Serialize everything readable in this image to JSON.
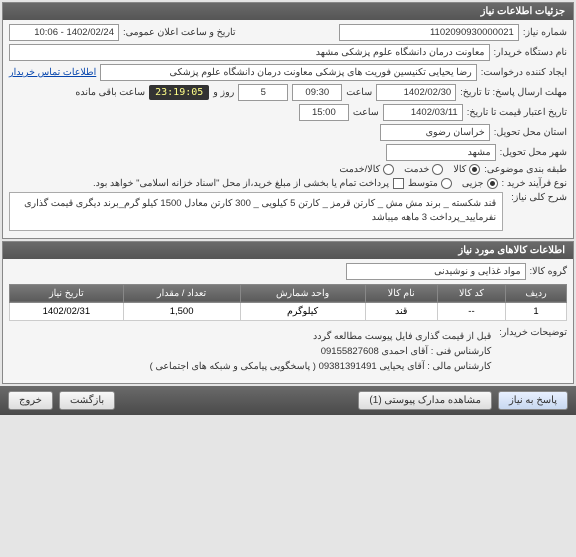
{
  "panel1": {
    "title": "جزئیات اطلاعات نیاز",
    "reqNoLabel": "شماره نیاز:",
    "reqNo": "1102090930000021",
    "announceLabel": "تاریخ و ساعت اعلان عمومی:",
    "announceVal": "1402/02/24 - 10:06",
    "buyerLabel": "نام دستگاه خریدار:",
    "buyerVal": "معاونت درمان دانشگاه علوم پزشکی مشهد",
    "creatorLabel": "ایجاد کننده درخواست:",
    "creatorVal": "رضا یحیایی تکنیسین فوریت های پزشکی معاونت درمان دانشگاه علوم پزشکی",
    "contactLink": "اطلاعات تماس خریدار",
    "deadlineLabel": "مهلت ارسال پاسخ: تا تاریخ:",
    "deadlineDate": "1402/02/30",
    "timeLabel": "ساعت",
    "deadlineTime": "09:30",
    "dayLabel": "روز و",
    "daysLeft": "5",
    "countdown": "23:19:05",
    "remaining": "ساعت باقی مانده",
    "validLabel": "تاریخ اعتبار قیمت تا تاریخ:",
    "validDate": "1402/03/11",
    "validTime": "15:00",
    "provinceLabel": "استان محل تحویل:",
    "province": "خراسان رضوی",
    "cityLabel": "شهر محل تحویل:",
    "city": "مشهد",
    "classLabel": "طبقه بندی موضوعی:",
    "class1": "کالا",
    "class2": "خدمت",
    "class3": "کالا/خدمت",
    "procLabel": "نوع فرآیند خرید :",
    "proc1": "جزیی",
    "proc2": "متوسط",
    "procNote": "پرداخت تمام یا بخشی از مبلغ خرید،از محل \"اسناد خزانه اسلامی\" خواهد بود.",
    "descLabel": "شرح کلی نیاز:",
    "desc": "قند شکسته _ برند مش مش _ کارتن قرمز _ کارتن 5 کیلویی _ 300 کارتن معادل 1500 کیلو گرم_برند دیگری قیمت گذاری نفرمایید_پرداخت 3 ماهه میباشد"
  },
  "panel2": {
    "title": "اطلاعات کالاهای مورد نیاز",
    "groupLabel": "گروه کالا:",
    "groupVal": "مواد غذایی و نوشیدنی",
    "headers": [
      "ردیف",
      "کد کالا",
      "نام کالا",
      "واحد شمارش",
      "تعداد / مقدار",
      "تاریخ نیاز"
    ],
    "row": {
      "idx": "1",
      "code": "--",
      "name": "قند",
      "unit": "کیلوگرم",
      "qty": "1,500",
      "date": "1402/02/31"
    },
    "notesLabel": "توضیحات خریدار:",
    "notes1": "قبل از قیمت گذاری فایل پیوست مطالعه گردد",
    "notes2": "کارشناس فنی : آقای احمدی 09155827608",
    "notes3": "کارشناس مالی : آقای یحیایی 09381391491 ( پاسخگویی پیامکی و شبکه های اجتماعی )"
  },
  "footer": {
    "respond": "پاسخ به نیاز",
    "attach": "مشاهده مدارک پیوستی (1)",
    "back": "بازگشت",
    "exit": "خروج"
  }
}
